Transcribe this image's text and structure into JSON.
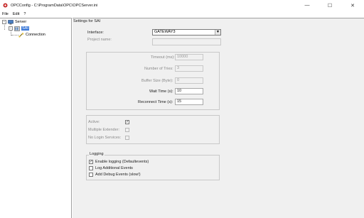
{
  "window": {
    "title": "OPCConfig - C:\\ProgramData\\OPC\\OPCServer.ini",
    "minimize": "—",
    "maximize": "☐",
    "close": "✕"
  },
  "menu": {
    "file": "File",
    "edit": "Edit",
    "help": "?"
  },
  "tree": {
    "root": "Server",
    "child": "SAI",
    "grandchild": "Connection",
    "expander_root": "−",
    "expander_child": "−"
  },
  "settings": {
    "header": "Settings for SAI",
    "interface_label": "Interface:",
    "interface_value": "GATEWAY3",
    "project_label": "Project name:",
    "project_value": "",
    "timeout_label": "Timeout (ms):",
    "timeout_value": "10000",
    "tries_label": "Number of Tries:",
    "tries_value": "3",
    "buffer_label": "Buffer Size (Byte):",
    "buffer_value": "0",
    "wait_label": "Wait Time (s):",
    "wait_value": "10",
    "reconnect_label": "Reconnect Time (s):",
    "reconnect_value": "15",
    "active_label": "Active:",
    "active_checked": "✓",
    "multiple_label": "Multiple Extender:",
    "nologin_label": "No Login Services:"
  },
  "logging": {
    "title": "Logging",
    "enable_label": "Enable logging (Defaultevents)",
    "enable_checked": "✓",
    "additional_label": "Log Additional Events",
    "debug_label": "Add Debug Events (slow!)"
  },
  "colors": {
    "selection": "#3a78d7",
    "app_icon": "#c62828"
  }
}
